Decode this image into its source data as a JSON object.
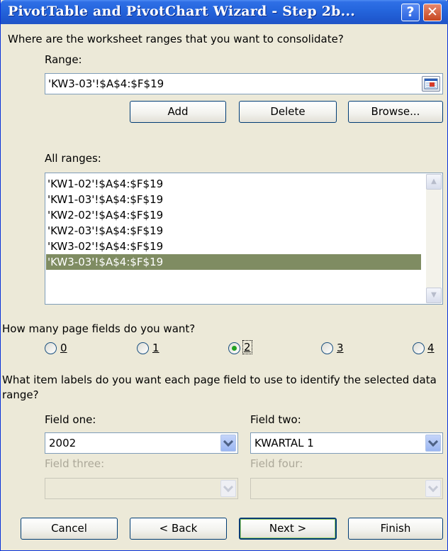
{
  "window": {
    "title": "PivotTable and PivotChart Wizard - Step 2b...",
    "help_icon": "?",
    "close_icon": "✕"
  },
  "ranges_section": {
    "question": "Where are the worksheet ranges that you want to consolidate?",
    "range_label": "Range:",
    "range_value": "'KW3-03'!$A$4:$F$19",
    "add_label": "Add",
    "delete_label": "Delete",
    "browse_label": "Browse...",
    "all_ranges_label": "All ranges:",
    "all_ranges": [
      "'KW1-02'!$A$4:$F$19",
      "'KW1-03'!$A$4:$F$19",
      "'KW2-02'!$A$4:$F$19",
      "'KW2-03'!$A$4:$F$19",
      "'KW3-02'!$A$4:$F$19",
      "'KW3-03'!$A$4:$F$19"
    ],
    "selected_index": 5
  },
  "page_fields": {
    "question": "How many page fields do you want?",
    "options": [
      "0",
      "1",
      "2",
      "3",
      "4"
    ],
    "selected": "2"
  },
  "labels_section": {
    "question": "What item labels do you want each page field to use to identify the selected data range?",
    "field_one_label": "Field one:",
    "field_one_value": "2002",
    "field_two_label": "Field two:",
    "field_two_value": "KWARTAL 1",
    "field_three_label": "Field three:",
    "field_three_value": "",
    "field_four_label": "Field four:",
    "field_four_value": ""
  },
  "footer": {
    "cancel": "Cancel",
    "back": "< Back",
    "next": "Next >",
    "finish": "Finish"
  },
  "colors": {
    "title_bar": "#2566dd",
    "selection": "#7f8c62",
    "dialog_bg": "#ece9d8",
    "radio_dot": "#21a121"
  }
}
